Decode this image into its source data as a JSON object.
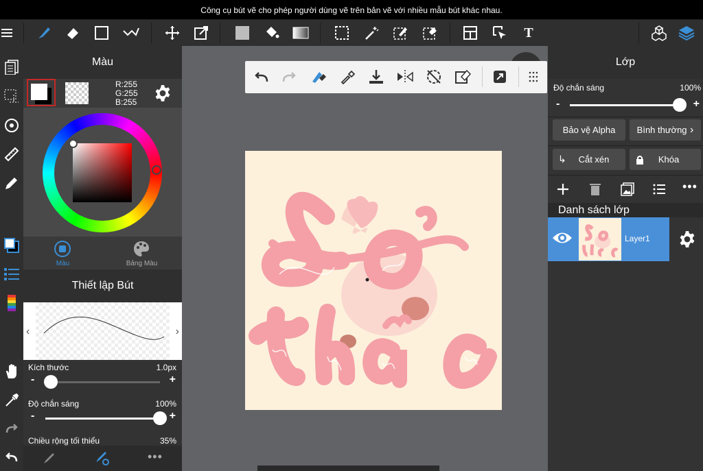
{
  "tooltip": "Công cụ bút vẽ cho phép người dùng vẽ trên bản vẽ với nhiều mẫu bút khác nhau.",
  "color_panel": {
    "title": "Màu",
    "rgb": {
      "r": "R:255",
      "g": "G:255",
      "b": "B:255"
    },
    "tabs": [
      {
        "label": "Màu",
        "active": true
      },
      {
        "label": "Bảng Màu",
        "active": false
      }
    ],
    "primary_color": "#ffffff",
    "secondary_color": "#000000"
  },
  "brush_settings": {
    "title": "Thiết lập Bút",
    "size": {
      "label": "Kích thước",
      "value": "1.0px",
      "level": 0.05
    },
    "opacity": {
      "label": "Độ chắn sáng",
      "value": "100%",
      "level": 1.0
    },
    "min_width": {
      "label": "Chiều rộng tối thiểu",
      "value": "35%"
    }
  },
  "layer_panel": {
    "title": "Lớp",
    "opacity": {
      "label": "Độ chắn sáng",
      "value": "100%",
      "level": 1.0
    },
    "alpha_protect": "Bảo vệ Alpha",
    "blend_mode": "Bình thường",
    "clipping": "Cắt xén",
    "lock": "Khóa",
    "list_title": "Danh sách lớp",
    "layers": [
      {
        "name": "Layer1",
        "visible": true,
        "selected": true
      }
    ]
  },
  "artwork": {
    "line1": "Sở",
    "line2": "thác"
  },
  "colors": {
    "accent": "#4a90d9",
    "artboard": "#fdf1dc",
    "ink": "#f4a0a6"
  }
}
